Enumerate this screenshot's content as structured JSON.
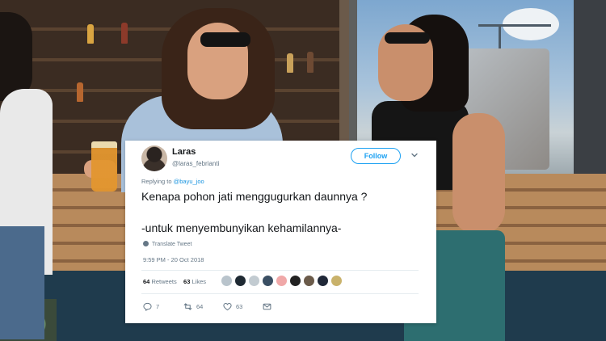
{
  "tweet": {
    "display_name": "Laras",
    "handle": "@laras_febrianti",
    "follow_label": "Follow",
    "replying_prefix": "Replying to",
    "replying_to": "@bayu_joo",
    "text_line1": "Kenapa pohon jati menggugurkan daunnya ?",
    "text_line2": "-untuk menyembunyikan kehamilannya-",
    "translate_label": "Translate Tweet",
    "timestamp": "9:59 PM - 20 Oct 2018",
    "retweets_count": "64",
    "retweets_label": "Retweets",
    "likes_count": "63",
    "likes_label": "Likes",
    "actions": {
      "reply_count": "7",
      "retweet_count": "64",
      "like_count": "63"
    }
  },
  "colors": {
    "twitter_blue": "#1da1f2",
    "text_dark": "#14171a",
    "text_muted": "#657786"
  },
  "liker_avatar_colors": [
    "#b9c4cc",
    "#1f2a33",
    "#c2cbd1",
    "#3a4f63",
    "#f0a8a8",
    "#222222",
    "#6b5b4a",
    "#202838",
    "#c9b26b"
  ]
}
